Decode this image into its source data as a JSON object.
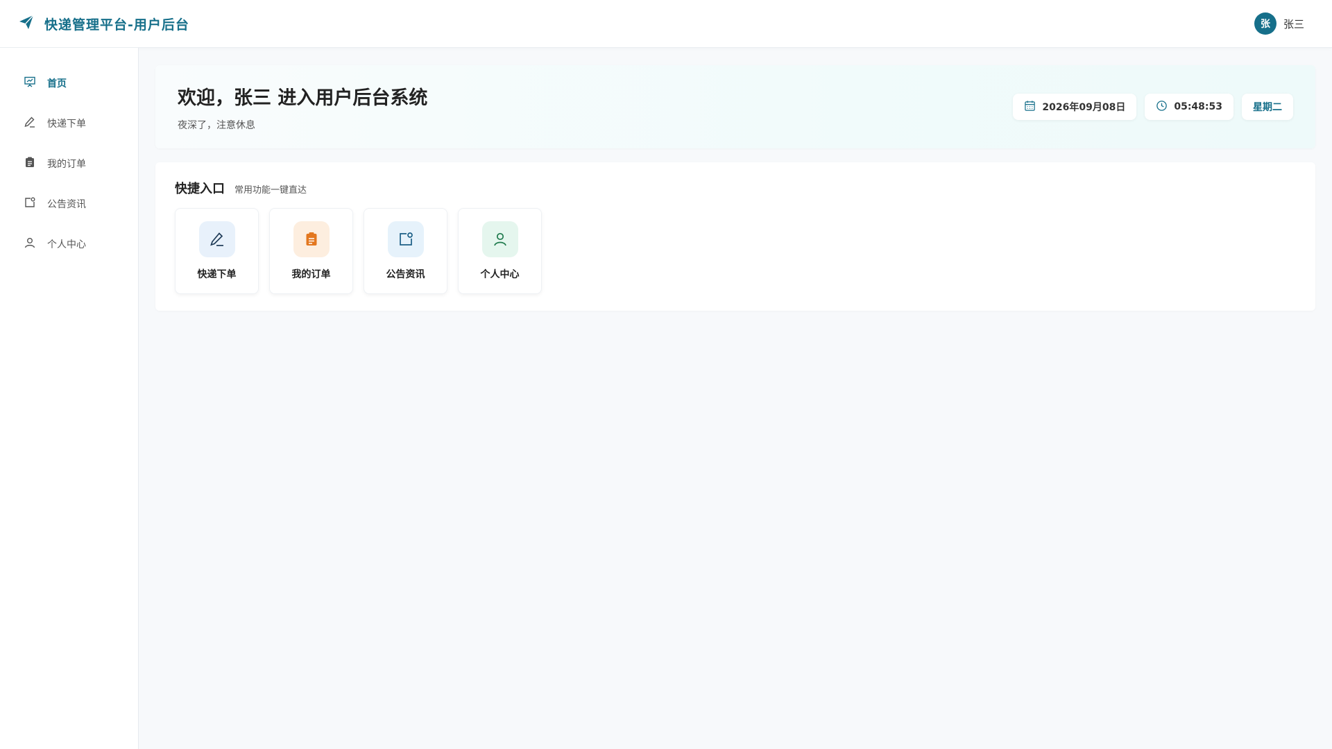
{
  "header": {
    "title": "快递管理平台-用户后台",
    "logo_icon": "paper-plane-icon",
    "brand_color": "#166f8a",
    "user": {
      "avatar_text": "张",
      "name": "张三"
    }
  },
  "sidebar": {
    "items": [
      {
        "label": "首页",
        "icon": "presentation-icon",
        "active": true
      },
      {
        "label": "快递下单",
        "icon": "pen-icon",
        "active": false
      },
      {
        "label": "我的订单",
        "icon": "clipboard-icon",
        "active": false
      },
      {
        "label": "公告资讯",
        "icon": "notice-icon",
        "active": false
      },
      {
        "label": "个人中心",
        "icon": "user-icon",
        "active": false
      }
    ]
  },
  "welcome": {
    "title": "欢迎，张三 进入用户后台系统",
    "subtitle": "夜深了，注意休息",
    "date": "2026年09月08日",
    "time": "05:48:53",
    "weekday": "星期二"
  },
  "quick": {
    "title": "快捷入口",
    "subtitle": "常用功能一键直达",
    "cards": [
      {
        "label": "快递下单",
        "icon": "pen-icon",
        "bg": "#e8f1fb",
        "color": "#1f3b57"
      },
      {
        "label": "我的订单",
        "icon": "clipboard-icon",
        "bg": "#fdeedf",
        "color": "#e3771f"
      },
      {
        "label": "公告资讯",
        "icon": "notice-icon",
        "bg": "#e6f2fb",
        "color": "#1c5f86"
      },
      {
        "label": "个人中心",
        "icon": "user-icon",
        "bg": "#e5f6ee",
        "color": "#1f7a4d"
      }
    ]
  }
}
